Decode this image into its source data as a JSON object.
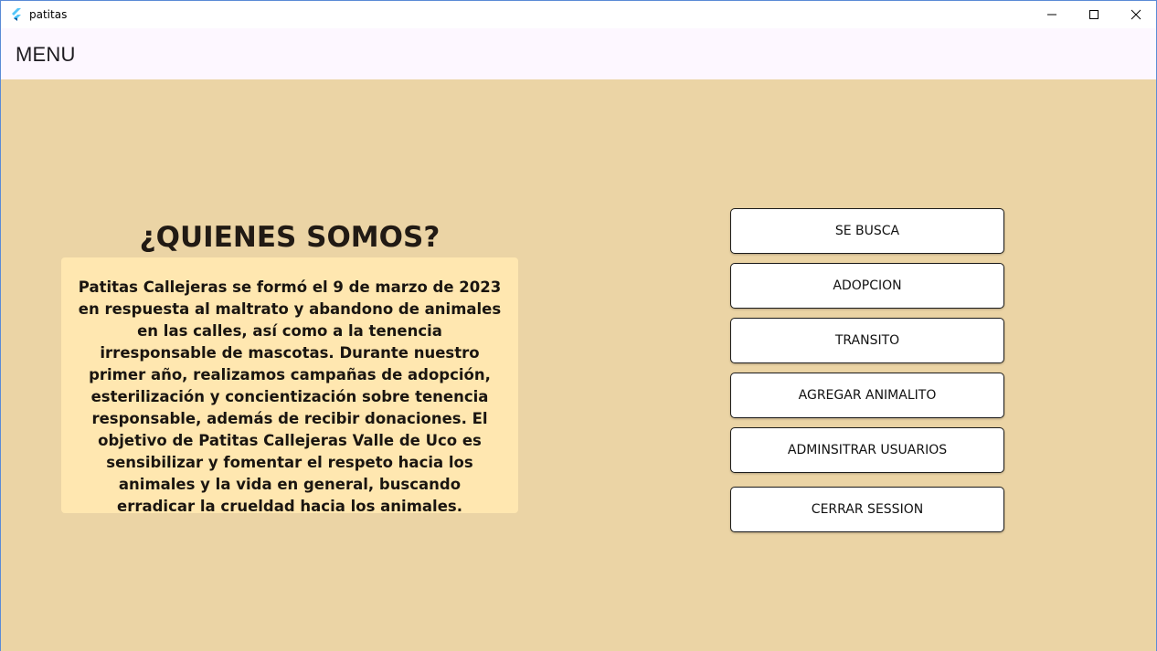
{
  "window": {
    "title": "patitas",
    "controls": [
      "minimize-icon",
      "maximize-icon",
      "close-icon"
    ]
  },
  "appbar": {
    "title": "MENU"
  },
  "about": {
    "heading": "¿QUIENES SOMOS?",
    "text": "Patitas Callejeras se formó el 9 de marzo de 2023 en respuesta al maltrato y abandono de animales en las calles, así como a la tenencia irresponsable de mascotas. Durante nuestro primer año, realizamos campañas de adopción, esterilización y concientización sobre tenencia responsable, además de recibir donaciones. El objetivo de Patitas Callejeras Valle de Uco es sensibilizar y fomentar el respeto hacia los animales y la vida en general, buscando erradicar la crueldad hacia los animales."
  },
  "menu": {
    "buttons": [
      "SE BUSCA",
      "ADOPCION",
      "TRANSITO",
      "AGREGAR ANIMALITO",
      "ADMINSITRAR USUARIOS",
      "CERRAR SESSION"
    ]
  },
  "colors": {
    "background": "#ebd4a5",
    "card": "#ffe7b0",
    "appbar": "#fdf7ff",
    "button": "#ffffff"
  }
}
